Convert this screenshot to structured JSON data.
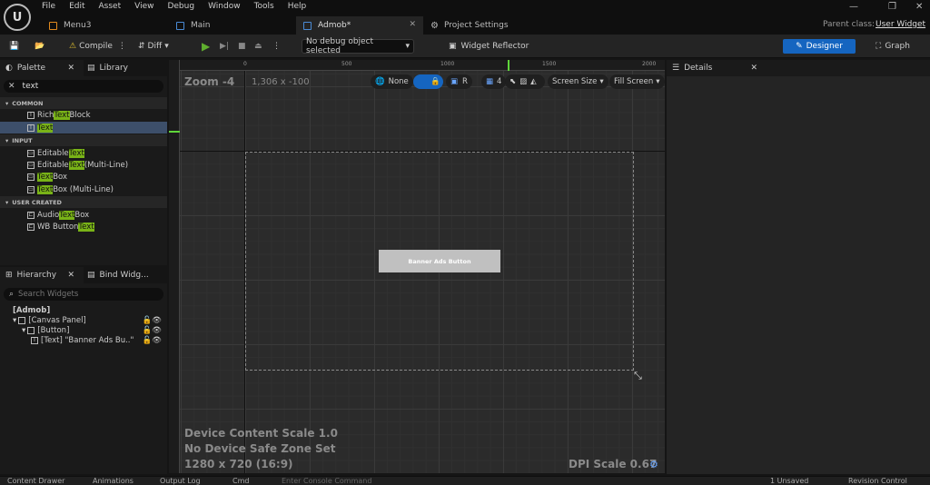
{
  "menu": [
    "File",
    "Edit",
    "Asset",
    "View",
    "Debug",
    "Window",
    "Tools",
    "Help"
  ],
  "tabs": [
    {
      "label": "Menu3"
    },
    {
      "label": "Main"
    },
    {
      "label": "Admob*"
    },
    {
      "label": "Project Settings"
    }
  ],
  "parent_class": {
    "label": "Parent class:",
    "value": "User Widget"
  },
  "toolbar": {
    "compile": "Compile",
    "diff": "Diff",
    "debug_object": "No debug object selected",
    "widget_reflector": "Widget Reflector",
    "designer": "Designer",
    "graph": "Graph"
  },
  "palette": {
    "tab": "Palette",
    "library_tab": "Library",
    "search_value": "text",
    "sections": {
      "common": "COMMON",
      "input": "INPUT",
      "user_created": "USER CREATED"
    },
    "items": {
      "rich_pre": "Rich ",
      "rich_hl": "Text",
      "rich_post": " Block",
      "text_hl": "Text",
      "edit_pre": "Editable ",
      "edit_hl": "Text",
      "editml_pre": "Editable ",
      "editml_hl": "Text",
      "editml_post": " (Multi-Line)",
      "tb_hl": "Text",
      "tb_post": " Box",
      "tbml_hl": "Text",
      "tbml_post": " Box (Multi-Line)",
      "audio_pre": "Audio ",
      "audio_hl": "Text",
      "audio_post": " Box",
      "wb_pre": "WB Button ",
      "wb_hl": "Text"
    }
  },
  "hierarchy": {
    "tab": "Hierarchy",
    "bind_tab": "Bind Widg...",
    "search_placeholder": "Search Widgets",
    "root": "[Admob]",
    "canvas_panel": "[Canvas Panel]",
    "button": "[Button]",
    "text_node": "[Text] \"Banner Ads Bu..\""
  },
  "designer": {
    "zoom": "Zoom -4",
    "resolution": "1,306 x -100",
    "none_label": "None",
    "r_label": "R",
    "grid_value": "4",
    "screen_size": "Screen Size",
    "fill_screen": "Fill Screen",
    "ruler_h": [
      "0",
      "500",
      "1000",
      "1500",
      "2000"
    ],
    "banner_button": "Banner Ads Button",
    "device_scale": "Device Content Scale 1.0",
    "safe_zone": "No Device Safe Zone Set",
    "device_res": "1280 x 720 (16:9)",
    "dpi_scale": "DPI Scale 0.67"
  },
  "details": {
    "tab": "Details"
  },
  "statusbar": {
    "content_drawer": "Content Drawer",
    "animations": "Animations",
    "output_log": "Output Log",
    "cmd": "Cmd",
    "console_placeholder": "Enter Console Command",
    "unsaved": "1 Unsaved",
    "revision": "Revision Control"
  },
  "colors": {
    "accent": "#1565c0",
    "highlight": "#79b317",
    "play": "#5fae2e"
  }
}
